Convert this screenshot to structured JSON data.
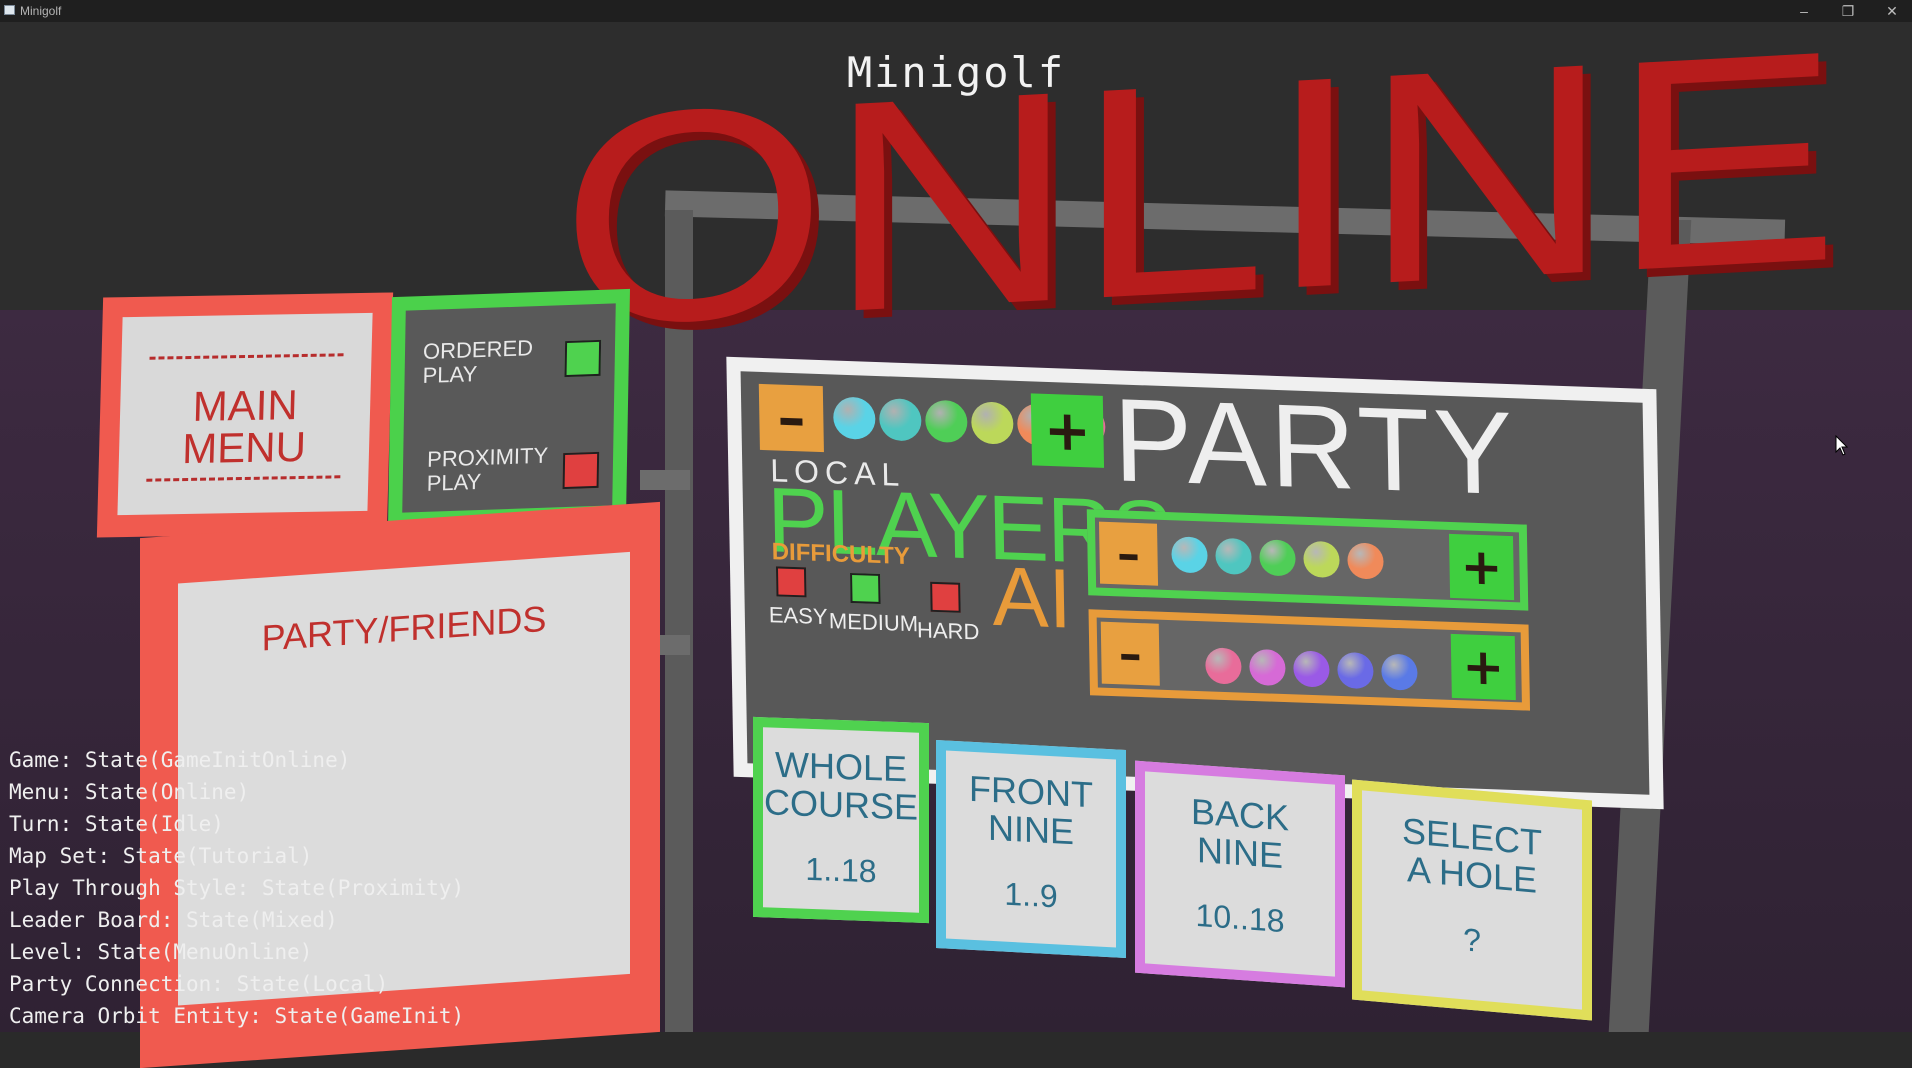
{
  "window": {
    "title": "Minigolf",
    "minimize": "–",
    "restore": "❐",
    "close": "✕"
  },
  "scene": {
    "game_title": "Minigolf",
    "sign_word": "ONLINE",
    "colors": {
      "red": "#b71c1c",
      "green": "#4fd24f",
      "orange": "#e89b3a",
      "coral": "#f05a4f",
      "blue": "#5ac0e0",
      "pink": "#d67ce0",
      "yellow": "#e0de5a"
    }
  },
  "main_menu": {
    "line1": "MAIN",
    "line2": "MENU"
  },
  "play_mode": {
    "ordered": {
      "line1": "ORDERED",
      "line2": "PLAY",
      "checked": true
    },
    "proximity": {
      "line1": "PROXIMITY",
      "line2": "PLAY",
      "checked": false
    }
  },
  "friends": {
    "label": "PARTY/FRIENDS"
  },
  "party": {
    "label": "PARTY",
    "minus": "–",
    "plus": "+",
    "ball_colors": [
      "#5ad3e6",
      "#4fc6c0",
      "#4fce57",
      "#bcd85a",
      "#f08a5a",
      "#e86c9a"
    ]
  },
  "players": {
    "local_label": "LOCAL",
    "label": "PLAYERS",
    "ball_colors": [
      "#5ad3e6",
      "#4fc6c0",
      "#4fce57",
      "#bcd85a",
      "#f08a5a"
    ]
  },
  "ai": {
    "difficulty_label": "DIFFICULTY",
    "label": "AI",
    "ball_colors": [
      "#e86c9a",
      "#d66ad6",
      "#9a5ae6",
      "#6a6ae6",
      "#5a7ae6"
    ],
    "levels": [
      {
        "label": "EASY",
        "checked": false
      },
      {
        "label": "MEDIUM",
        "checked": true
      },
      {
        "label": "HARD",
        "checked": false
      }
    ]
  },
  "courses": [
    {
      "title1": "WHOLE",
      "title2": "COURSE",
      "range": "1..18",
      "color": "#4fd24f"
    },
    {
      "title1": "FRONT",
      "title2": "NINE",
      "range": "1..9",
      "color": "#5ac0e0"
    },
    {
      "title1": "BACK",
      "title2": "NINE",
      "range": "10..18",
      "color": "#d67ce0"
    },
    {
      "title1": "SELECT",
      "title2": "A HOLE",
      "range": "?",
      "color": "#e0de5a"
    }
  ],
  "debug": [
    "Game: State(GameInitOnline)",
    "Menu: State(Online)",
    "Turn: State(Idle)",
    "Map Set: State(Tutorial)",
    "Play Through Style: State(Proximity)",
    "Leader Board: State(Mixed)",
    "Level: State(MenuOnline)",
    "Party Connection: State(Local)",
    "Camera Orbit Entity: State(GameInit)"
  ]
}
